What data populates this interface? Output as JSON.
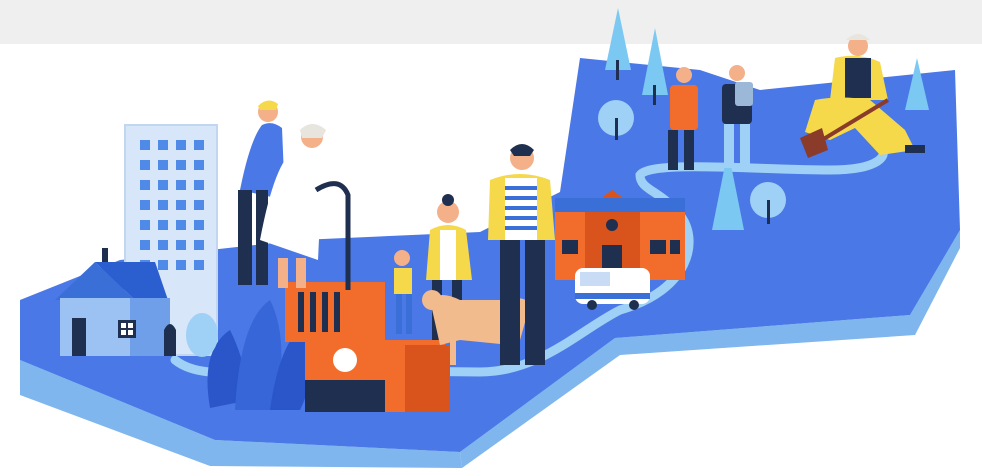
{
  "scene": {
    "description_visible_text": [],
    "colors": {
      "background": "#ffffff",
      "top_band": "#efefef",
      "ground_top": "#4a78e6",
      "ground_side": "#7fb6ee",
      "building_light": "#c9dcf6",
      "window_blue": "#3b6fd8",
      "orange": "#f26c2c",
      "orange_dark": "#d9541c",
      "navy": "#1f2f4f",
      "yellow": "#f5d94a",
      "skin": "#f3b089",
      "dog": "#f2bb8d",
      "tree": "#7bc8f2",
      "bush_dark": "#2a56c9",
      "white": "#ffffff"
    }
  }
}
